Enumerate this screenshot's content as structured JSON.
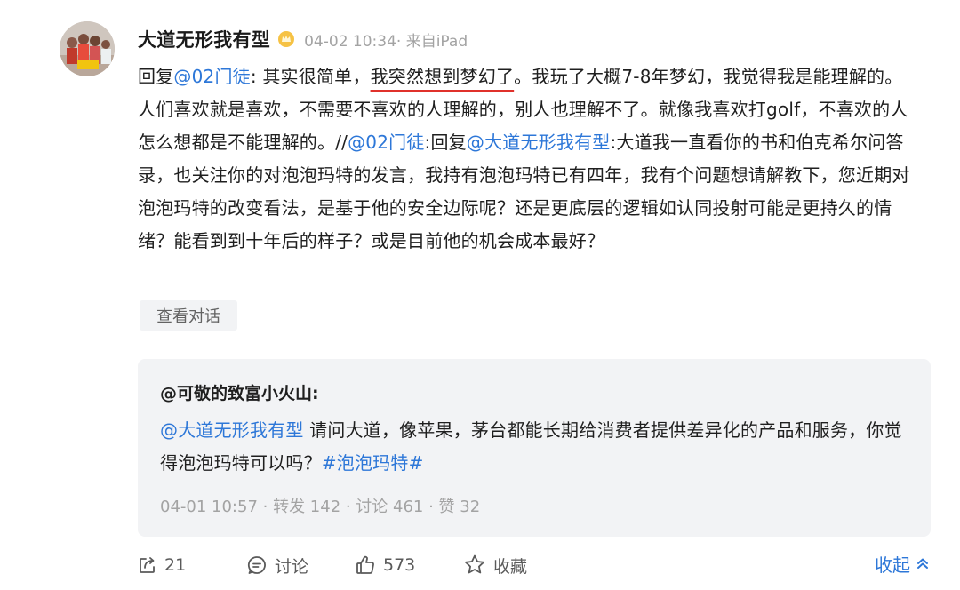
{
  "post": {
    "author": "大道无形我有型",
    "badge_icon": "crown-badge-icon",
    "meta": "04-02 10:34· 来自iPad",
    "reply_prefix": "回复",
    "reply_to_mention": "@02门徒",
    "text_part1": ": 其实很简单，",
    "text_highlight": "我突然想到梦幻了",
    "text_part2": "。我玩了大概7-8年梦幻，我觉得我是能理解的。人们喜欢就是喜欢，不需要不喜欢的人理解的，别人也理解不了。就像我喜欢打golf，不喜欢的人怎么想都是不能理解的。//",
    "forward_mention": "@02门徒",
    "text_part3": ":回复",
    "forward_mention_2": "@大道无形我有型",
    "text_part4": ":大道我一直看你的书和伯克希尔问答录，也关注你的对泡泡玛特的发言，我持有泡泡玛特已有四年，我有个问题想请解教下，您近期对泡泡玛特的改变看法，是基于他的安全边际呢？还是更底层的逻辑如认同投射可能是更持久的情绪？能看到到十年后的样子？或是目前他的机会成本最好？",
    "view_conversation": "查看对话",
    "highlight_color": "#e0312b",
    "link_color": "#2d77d8"
  },
  "quote": {
    "author": "@可敬的致富小火山:",
    "mention": "@大道无形我有型",
    "text": " 请问大道，像苹果，茅台都能长期给消费者提供差异化的产品和服务，你觉得泡泡玛特可以吗？",
    "topic": "#泡泡玛特#",
    "meta": "04-01 10:57 · 转发 142 · 讨论 461 · 赞 32"
  },
  "actions": {
    "repost_count": "21",
    "comment_label": "讨论",
    "like_count": "573",
    "favorite_label": "收藏",
    "collapse_label": "收起"
  }
}
